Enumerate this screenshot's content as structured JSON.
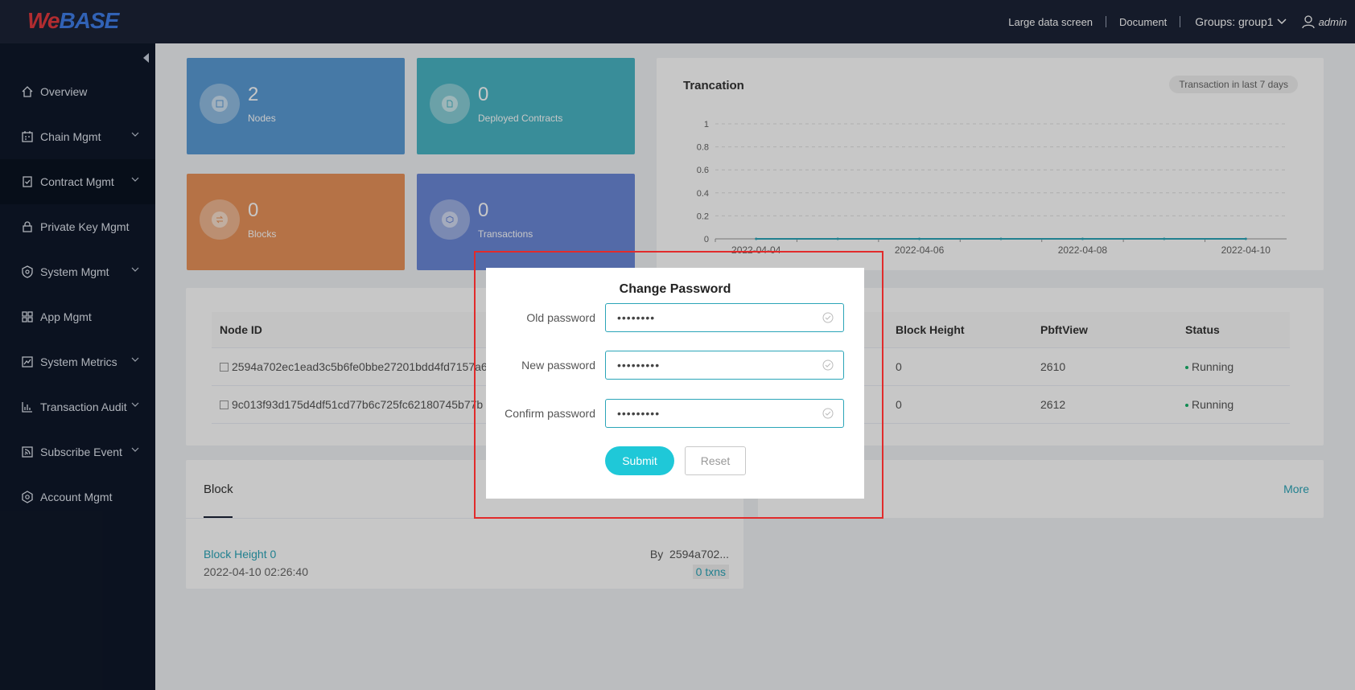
{
  "header": {
    "logo_we": "We",
    "logo_base": "BASE",
    "large_screen": "Large data screen",
    "document": "Document",
    "groups": "Groups: group1",
    "user": "admin"
  },
  "sidebar": {
    "items": [
      {
        "label": "Overview",
        "icon": "home-icon"
      },
      {
        "label": "Chain Mgmt",
        "icon": "calendar-icon"
      },
      {
        "label": "Contract Mgmt",
        "icon": "clipboard-check-icon"
      },
      {
        "label": "Private Key Mgmt",
        "icon": "lock-icon"
      },
      {
        "label": "System Mgmt",
        "icon": "shield-icon"
      },
      {
        "label": "App Mgmt",
        "icon": "apps-grid-icon"
      },
      {
        "label": "System Metrics",
        "icon": "metrics-icon"
      },
      {
        "label": "Transaction Audit",
        "icon": "bar-chart-icon"
      },
      {
        "label": "Subscribe Event",
        "icon": "rss-icon"
      },
      {
        "label": "Account Mgmt",
        "icon": "account-icon"
      }
    ]
  },
  "stats": {
    "nodes": {
      "value": "2",
      "label": "Nodes",
      "color": "#5a9bd5"
    },
    "contracts": {
      "value": "0",
      "label": "Deployed Contracts",
      "color": "#4ab5c4"
    },
    "blocks": {
      "value": "0",
      "label": "Blocks",
      "color": "#e8935a"
    },
    "transactions": {
      "value": "0",
      "label": "Transactions",
      "color": "#6b88d8"
    }
  },
  "chart_data": {
    "type": "line",
    "title": "Trancation",
    "badge": "Transaction in last 7 days",
    "x": [
      "2022-04-04",
      "2022-04-05",
      "2022-04-06",
      "2022-04-07",
      "2022-04-08",
      "2022-04-09",
      "2022-04-10"
    ],
    "x_tick_labels": [
      "2022-04-04",
      "2022-04-06",
      "2022-04-08",
      "2022-04-10"
    ],
    "y_ticks": [
      "0",
      "0.2",
      "0.4",
      "0.6",
      "0.8",
      "1"
    ],
    "values": [
      0,
      0,
      0,
      0,
      0,
      0,
      0
    ],
    "ylim": [
      0,
      1
    ],
    "grid": true,
    "line_color": "#2ba5b8"
  },
  "node_table": {
    "headers": [
      "Node ID",
      "Block Height",
      "PbftView",
      "Status"
    ],
    "rows": [
      {
        "id": "2594a702ec1ead3c5b6fe0bbe27201bdd4fd7157a6",
        "height": "0",
        "pbft": "2610",
        "status": "Running"
      },
      {
        "id": "9c013f93d175d4df51cd77b6c725fc62180745b77b",
        "height": "0",
        "pbft": "2612",
        "status": "Running"
      }
    ]
  },
  "block_card": {
    "tab": "Block",
    "height_link": "Block Height 0",
    "time": "2022-04-10 02:26:40",
    "by_label": "By",
    "by_value": "2594a702...",
    "txns": "0 txns"
  },
  "tx_card": {
    "more": "More"
  },
  "dialog": {
    "title": "Change Password",
    "old_label": "Old password",
    "old_value": "••••••••",
    "new_label": "New password",
    "new_value": "•••••••••",
    "confirm_label": "Confirm password",
    "confirm_value": "•••••••••",
    "submit": "Submit",
    "reset": "Reset"
  }
}
